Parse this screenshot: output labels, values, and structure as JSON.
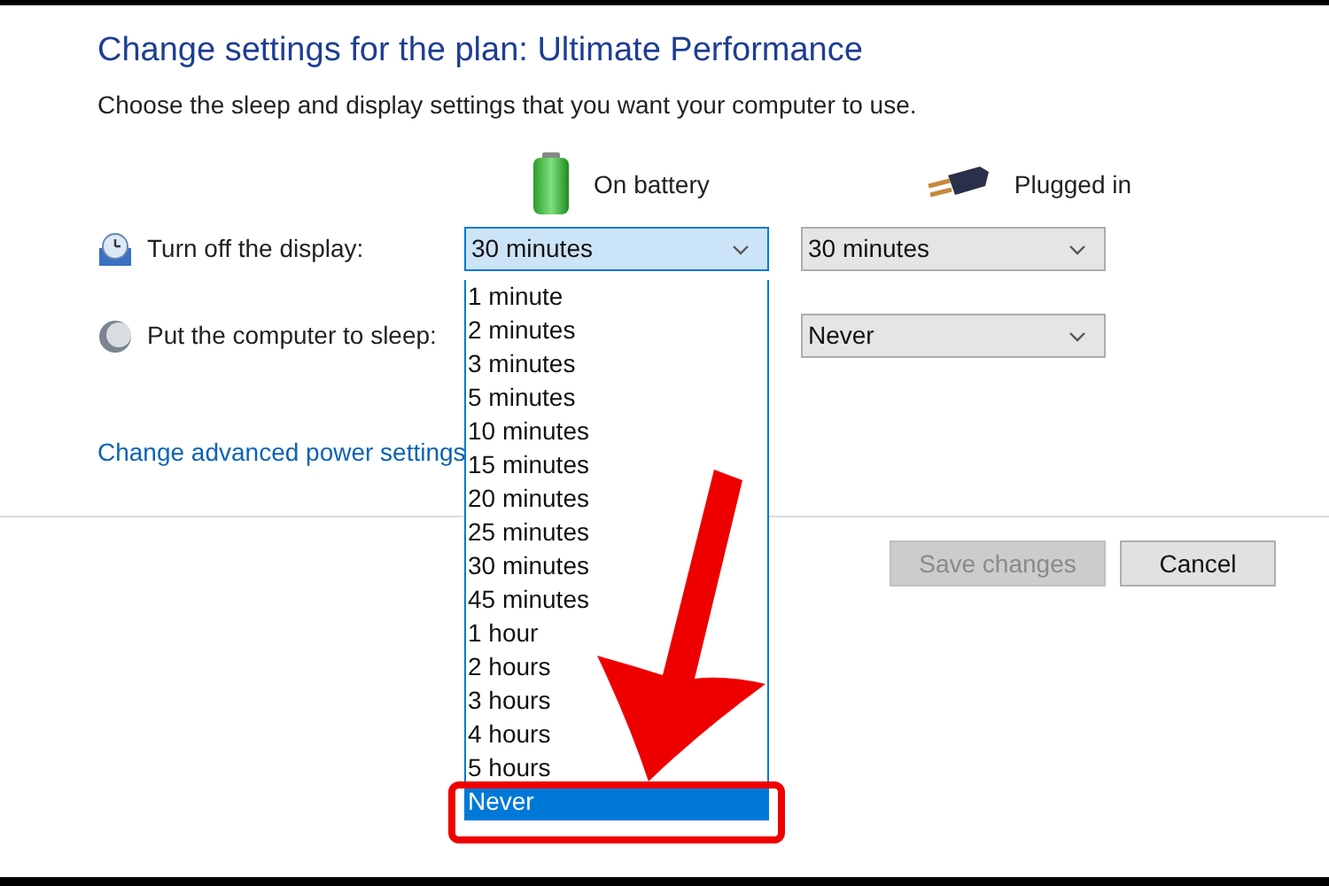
{
  "title": "Change settings for the plan: Ultimate Performance",
  "subtitle": "Choose the sleep and display settings that you want your computer to use.",
  "columns": [
    {
      "label": "On battery",
      "kind": "battery"
    },
    {
      "label": "Plugged in",
      "kind": "plug"
    }
  ],
  "settings": [
    {
      "label": "Turn off the display:",
      "kind": "display",
      "on_battery": {
        "value": "30 minutes",
        "expanded": true
      },
      "plugged_in": {
        "value": "30 minutes"
      }
    },
    {
      "label": "Put the computer to sleep:",
      "kind": "sleep",
      "plugged_in": {
        "value": "Never"
      }
    }
  ],
  "dropdown_list": [
    {
      "label": "1 minute",
      "selected": false
    },
    {
      "label": "2 minutes",
      "selected": false
    },
    {
      "label": "3 minutes",
      "selected": false
    },
    {
      "label": "5 minutes",
      "selected": false
    },
    {
      "label": "10 minutes",
      "selected": false
    },
    {
      "label": "15 minutes",
      "selected": false
    },
    {
      "label": "20 minutes",
      "selected": false
    },
    {
      "label": "25 minutes",
      "selected": false
    },
    {
      "label": "30 minutes",
      "selected": false
    },
    {
      "label": "45 minutes",
      "selected": false
    },
    {
      "label": "1 hour",
      "selected": false
    },
    {
      "label": "2 hours",
      "selected": false
    },
    {
      "label": "3 hours",
      "selected": false
    },
    {
      "label": "4 hours",
      "selected": false
    },
    {
      "label": "5 hours",
      "selected": false
    },
    {
      "label": "Never",
      "selected": true
    }
  ],
  "link": "Change advanced power settings",
  "buttons": [
    {
      "label": "Save changes",
      "disabled": true
    },
    {
      "label": "Cancel",
      "disabled": false
    }
  ]
}
